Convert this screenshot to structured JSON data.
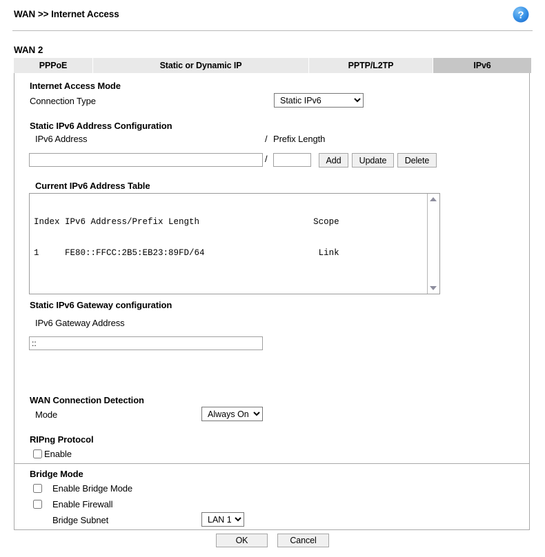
{
  "header": {
    "breadcrumb": "WAN >> Internet Access",
    "help_icon": "help-question-icon",
    "help_color": "#2f8fe8"
  },
  "wan": {
    "label": "WAN 2"
  },
  "tabs": [
    {
      "label": "PPPoE",
      "active": false
    },
    {
      "label": "Static or Dynamic IP",
      "active": false
    },
    {
      "label": "PPTP/L2TP",
      "active": false
    },
    {
      "label": "IPv6",
      "active": true
    }
  ],
  "internet_access_mode": {
    "section_title": "Internet Access Mode",
    "connection_type_label": "Connection Type",
    "connection_type_value": "Static IPv6",
    "connection_type_options": [
      "Static IPv6"
    ]
  },
  "static_ipv6_address": {
    "section_title": "Static IPv6 Address Configuration",
    "address_label": "IPv6 Address",
    "separator": "/",
    "prefix_label": "Prefix Length",
    "address_value": "",
    "address_placeholder": "",
    "prefix_value": "",
    "prefix_placeholder": "",
    "add_label": "Add",
    "update_label": "Update",
    "delete_label": "Delete"
  },
  "current_table": {
    "title": "Current IPv6 Address Table",
    "header_line": "Index IPv6 Address/Prefix Length                      Scope",
    "rows": [
      "1     FE80::FFCC:2B5:EB23:89FD/64                      Link"
    ],
    "columns": [
      "Index",
      "IPv6 Address/Prefix Length",
      "Scope"
    ],
    "entries": [
      {
        "index": "1",
        "address": "FE80::FFCC:2B5:EB23:89FD/64",
        "scope": "Link"
      }
    ],
    "scroll_up_icon": "scroll-up-arrow-icon",
    "scroll_down_icon": "scroll-down-arrow-icon"
  },
  "gateway": {
    "section_title": "Static IPv6 Gateway configuration",
    "address_label": "IPv6 Gateway Address",
    "address_value": "::",
    "address_placeholder": ""
  },
  "wan_detection": {
    "section_title": "WAN Connection Detection",
    "mode_label": "Mode",
    "mode_value": "Always On",
    "mode_options": [
      "Always On"
    ]
  },
  "ripng": {
    "section_title": "RIPng Protocol",
    "enable_label": "Enable",
    "enable_checked": false
  },
  "bridge_mode": {
    "section_title": "Bridge Mode",
    "enable_bridge_label": "Enable Bridge Mode",
    "enable_bridge_checked": false,
    "enable_firewall_label": "Enable Firewall",
    "enable_firewall_checked": false,
    "bridge_subnet_label": "Bridge Subnet",
    "bridge_subnet_value": "LAN 1",
    "bridge_subnet_options": [
      "LAN 1"
    ]
  },
  "footer": {
    "ok_label": "OK",
    "cancel_label": "Cancel"
  }
}
